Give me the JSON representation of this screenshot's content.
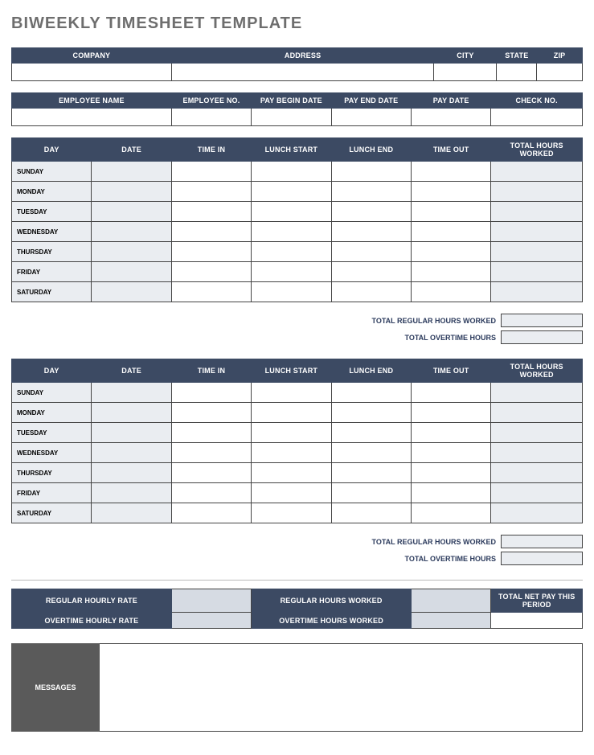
{
  "title": "BIWEEKLY TIMESHEET TEMPLATE",
  "company_table": {
    "headers": [
      "COMPANY",
      "ADDRESS",
      "CITY",
      "STATE",
      "ZIP"
    ],
    "values": [
      "",
      "",
      "",
      "",
      ""
    ]
  },
  "employee_table": {
    "headers": [
      "EMPLOYEE NAME",
      "EMPLOYEE NO.",
      "PAY BEGIN DATE",
      "PAY END DATE",
      "PAY DATE",
      "CHECK NO."
    ],
    "values": [
      "",
      "",
      "",
      "",
      "",
      ""
    ]
  },
  "week_headers": [
    "DAY",
    "DATE",
    "TIME IN",
    "LUNCH START",
    "LUNCH END",
    "TIME OUT",
    "TOTAL HOURS WORKED"
  ],
  "days": [
    "SUNDAY",
    "MONDAY",
    "TUESDAY",
    "WEDNESDAY",
    "THURSDAY",
    "FRIDAY",
    "SATURDAY"
  ],
  "week1": [
    [
      "",
      "",
      "",
      "",
      "",
      ""
    ],
    [
      "",
      "",
      "",
      "",
      "",
      ""
    ],
    [
      "",
      "",
      "",
      "",
      "",
      ""
    ],
    [
      "",
      "",
      "",
      "",
      "",
      ""
    ],
    [
      "",
      "",
      "",
      "",
      "",
      ""
    ],
    [
      "",
      "",
      "",
      "",
      "",
      ""
    ],
    [
      "",
      "",
      "",
      "",
      "",
      ""
    ]
  ],
  "week2": [
    [
      "",
      "",
      "",
      "",
      "",
      ""
    ],
    [
      "",
      "",
      "",
      "",
      "",
      ""
    ],
    [
      "",
      "",
      "",
      "",
      "",
      ""
    ],
    [
      "",
      "",
      "",
      "",
      "",
      ""
    ],
    [
      "",
      "",
      "",
      "",
      "",
      ""
    ],
    [
      "",
      "",
      "",
      "",
      "",
      ""
    ],
    [
      "",
      "",
      "",
      "",
      "",
      ""
    ]
  ],
  "summary_labels": {
    "regular": "TOTAL REGULAR HOURS WORKED",
    "overtime": "TOTAL OVERTIME HOURS"
  },
  "summary_values": {
    "week1_regular": "",
    "week1_overtime": "",
    "week2_regular": "",
    "week2_overtime": ""
  },
  "rates": {
    "headers": {
      "reg_rate": "REGULAR HOURLY RATE",
      "reg_hours": "REGULAR HOURS WORKED",
      "ot_rate": "OVERTIME HOURLY RATE",
      "ot_hours": "OVERTIME HOURS WORKED",
      "net": "TOTAL NET PAY THIS PERIOD"
    },
    "values": {
      "reg_rate": "",
      "reg_hours": "",
      "ot_rate": "",
      "ot_hours": "",
      "net": ""
    }
  },
  "messages_label": "MESSAGES",
  "messages_value": ""
}
